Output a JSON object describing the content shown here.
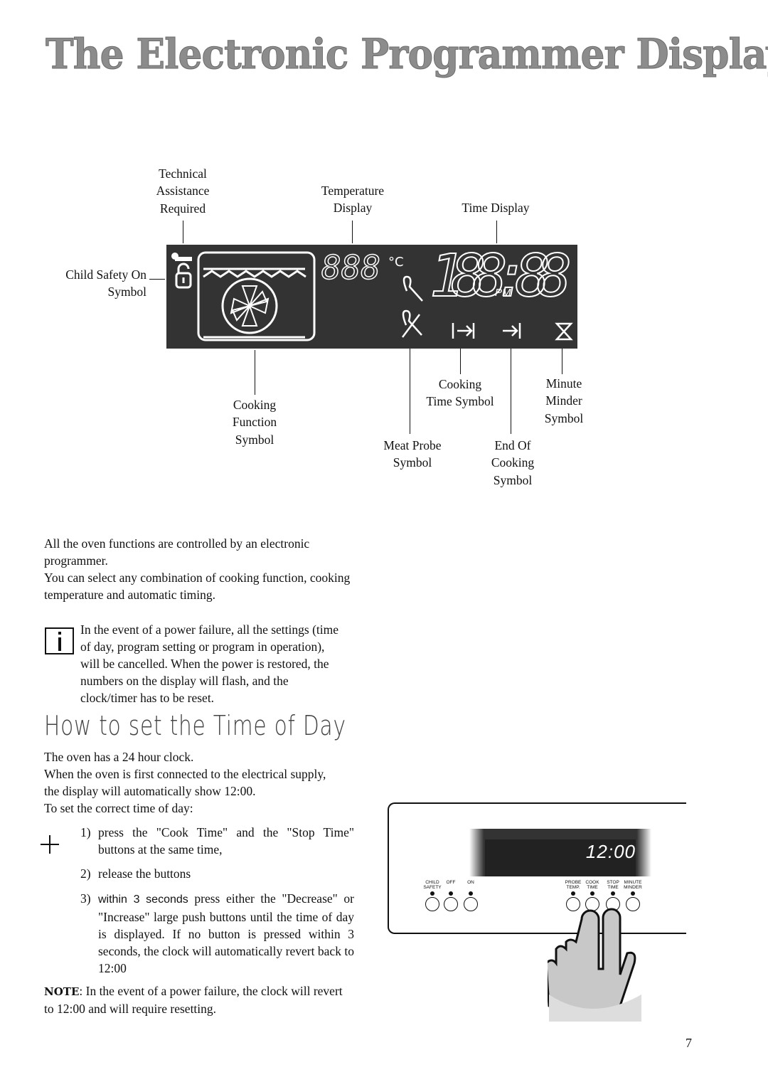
{
  "title": "The Electronic Programmer Display",
  "labels": {
    "technical": [
      "Technical",
      "Assistance",
      "Required"
    ],
    "temperature": [
      "Temperature",
      "Display"
    ],
    "time_display": "Time Display",
    "child_safety": [
      "Child Safety On",
      "Symbol"
    ],
    "cooking_function": [
      "Cooking",
      "Function",
      "Symbol"
    ],
    "cooking_time": [
      "Cooking",
      "Time Symbol"
    ],
    "minute_minder": [
      "Minute",
      "Minder",
      "Symbol"
    ],
    "meat_probe": [
      "Meat Probe",
      "Symbol"
    ],
    "end_of_cooking": [
      "End Of",
      "Cooking",
      "Symbol"
    ]
  },
  "display": {
    "temp_digits": "888",
    "time_digits": "188:88",
    "pm": "PM",
    "background": "#333333"
  },
  "intro": [
    "All the oven functions are controlled by an electronic programmer.",
    "You can select any combination of cooking function, cooking temperature and automatic timing."
  ],
  "info_note": "In the event of a power failure, all the settings (time of day, program setting or program in operation), will be cancelled. When the power is restored, the numbers on the display will flash, and the clock/timer has to be reset.",
  "section_title": "How to set the Time of Day",
  "section_text": [
    "The oven has a 24 hour clock.",
    "When the oven is first connected to the electrical supply, the display will automatically show 12:00.",
    "To set the correct time of day:"
  ],
  "steps": [
    {
      "n": "1)",
      "text": "press the \"Cook Time\" and the \"Stop Time\" buttons  at the same time,"
    },
    {
      "n": "2)",
      "text": "release the buttons"
    },
    {
      "n": "3)",
      "lead": "within 3 seconds",
      "text": " press either the \"Decrease\" or \"Increase\" large push buttons until the time of day is displayed. If no button is pressed within 3 seconds, the clock will automatically revert back to 12:00"
    }
  ],
  "note": {
    "label": "NOTE",
    "text": ": In the event of a power failure, the clock will revert to 12:00 and will require resetting."
  },
  "panel": {
    "clock": "12:00",
    "left_buttons": [
      [
        "CHILD",
        "SAFETY"
      ],
      [
        "",
        "OFF"
      ],
      [
        "",
        "ON"
      ]
    ],
    "right_buttons": [
      [
        "PROBE",
        "TEMP."
      ],
      [
        "COOK",
        "TIME"
      ],
      [
        "STOP",
        "TIME"
      ],
      [
        "MINUTE",
        "MINDER"
      ]
    ]
  },
  "page_number": "7"
}
